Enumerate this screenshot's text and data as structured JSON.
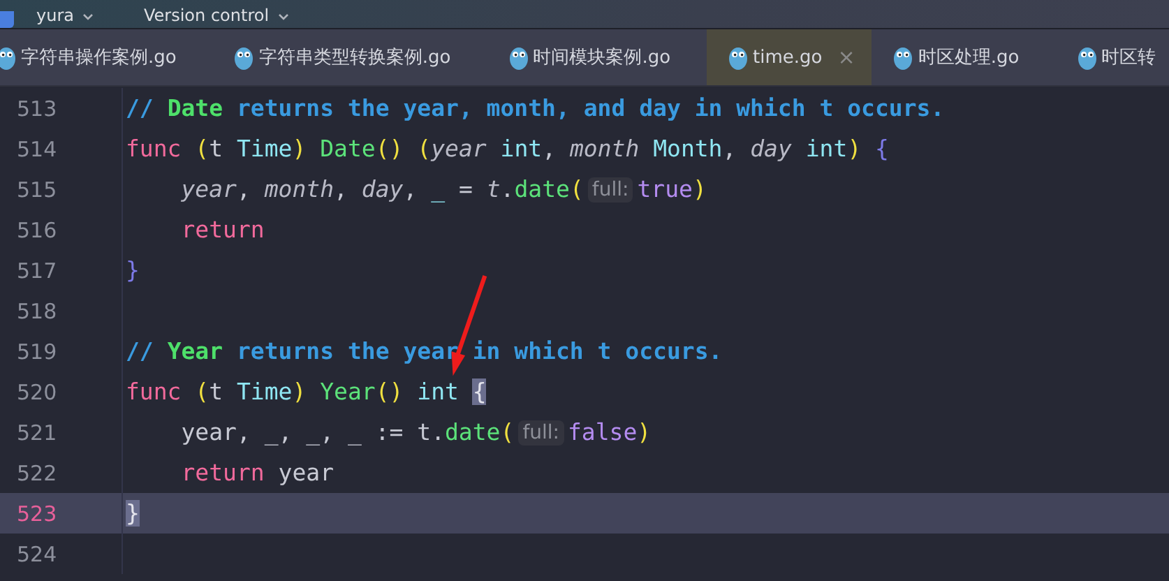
{
  "top_bar": {
    "project": "yura",
    "vcs": "Version control"
  },
  "tabs": [
    {
      "label": "字符串操作案例.go",
      "selected": false
    },
    {
      "label": "字符串类型转换案例.go",
      "selected": false
    },
    {
      "label": "时间模块案例.go",
      "selected": false
    },
    {
      "label": "time.go",
      "selected": true,
      "close": "×"
    },
    {
      "label": "时区处理.go",
      "selected": false
    },
    {
      "label": "时区转",
      "selected": false
    }
  ],
  "lines": [
    {
      "number": "513",
      "current": false,
      "tokens": [
        {
          "text": "// ",
          "kind": "comment"
        },
        {
          "text": "Date",
          "kind": "doc-name"
        },
        {
          "text": " returns the year, month, and day in which t occurs.",
          "kind": "comment"
        }
      ]
    },
    {
      "number": "514",
      "current": false,
      "tokens": [
        {
          "text": "func",
          "kind": "keyword"
        },
        {
          "text": " (",
          "kind": "paren"
        },
        {
          "text": "t",
          "kind": "receiver"
        },
        {
          "text": " Time",
          "kind": "type"
        },
        {
          "text": ")",
          "kind": "paren"
        },
        {
          "text": " Date",
          "kind": "func"
        },
        {
          "text": "()",
          "kind": "paren"
        },
        {
          "text": " (",
          "kind": "paren"
        },
        {
          "text": "year",
          "kind": "param"
        },
        {
          "text": " int",
          "kind": "type"
        },
        {
          "text": ", ",
          "kind": "plain"
        },
        {
          "text": "month",
          "kind": "param"
        },
        {
          "text": " Month",
          "kind": "type"
        },
        {
          "text": ", ",
          "kind": "plain"
        },
        {
          "text": "day",
          "kind": "param"
        },
        {
          "text": " int",
          "kind": "type"
        },
        {
          "text": ")",
          "kind": "paren"
        },
        {
          "text": " {",
          "kind": "brace"
        }
      ]
    },
    {
      "number": "515",
      "current": false,
      "tokens": [
        {
          "text": "    year",
          "kind": "param"
        },
        {
          "text": ", ",
          "kind": "plain"
        },
        {
          "text": "month",
          "kind": "param"
        },
        {
          "text": ", ",
          "kind": "plain"
        },
        {
          "text": "day",
          "kind": "param"
        },
        {
          "text": ", ",
          "kind": "plain"
        },
        {
          "text": "_",
          "kind": "type"
        },
        {
          "text": " = ",
          "kind": "plain"
        },
        {
          "text": "t",
          "kind": "param"
        },
        {
          "text": ".",
          "kind": "plain"
        },
        {
          "text": "date",
          "kind": "func"
        },
        {
          "text": "(",
          "kind": "paren"
        },
        {
          "text": "full:",
          "kind": "hint"
        },
        {
          "text": "true",
          "kind": "bool"
        },
        {
          "text": ")",
          "kind": "paren"
        }
      ]
    },
    {
      "number": "516",
      "current": false,
      "tokens": [
        {
          "text": "    return",
          "kind": "keyword"
        }
      ]
    },
    {
      "number": "517",
      "current": false,
      "tokens": [
        {
          "text": "}",
          "kind": "brace"
        }
      ]
    },
    {
      "number": "518",
      "current": false
    },
    {
      "number": "519",
      "current": false,
      "tokens": [
        {
          "text": "// ",
          "kind": "comment"
        },
        {
          "text": "Year",
          "kind": "doc-name"
        },
        {
          "text": " returns the year in which t occurs.",
          "kind": "comment"
        }
      ]
    },
    {
      "number": "520",
      "current": false,
      "tokens": [
        {
          "text": "func",
          "kind": "keyword"
        },
        {
          "text": " (",
          "kind": "paren"
        },
        {
          "text": "t",
          "kind": "receiver"
        },
        {
          "text": " Time",
          "kind": "type"
        },
        {
          "text": ")",
          "kind": "paren"
        },
        {
          "text": " Year",
          "kind": "func"
        },
        {
          "text": "()",
          "kind": "paren"
        },
        {
          "text": " int ",
          "kind": "type"
        },
        {
          "text": "{",
          "kind": "brace-match"
        }
      ]
    },
    {
      "number": "521",
      "current": false,
      "tokens": [
        {
          "text": "    year, _, _, _ := ",
          "kind": "plain"
        },
        {
          "text": "t",
          "kind": "receiver"
        },
        {
          "text": ".",
          "kind": "plain"
        },
        {
          "text": "date",
          "kind": "func"
        },
        {
          "text": "(",
          "kind": "paren"
        },
        {
          "text": "full:",
          "kind": "hint"
        },
        {
          "text": "false",
          "kind": "bool"
        },
        {
          "text": ")",
          "kind": "paren"
        }
      ]
    },
    {
      "number": "522",
      "current": false,
      "tokens": [
        {
          "text": "    return",
          "kind": "keyword"
        },
        {
          "text": " year",
          "kind": "plain"
        }
      ]
    },
    {
      "number": "523",
      "current": true,
      "tokens": [
        {
          "text": "}",
          "kind": "brace-match"
        }
      ]
    },
    {
      "number": "524",
      "current": false
    }
  ]
}
